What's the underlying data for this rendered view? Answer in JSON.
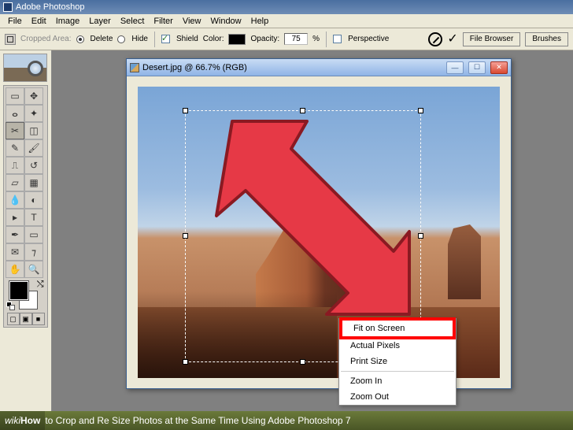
{
  "app": {
    "title": "Adobe Photoshop"
  },
  "menu": [
    "File",
    "Edit",
    "Image",
    "Layer",
    "Select",
    "Filter",
    "View",
    "Window",
    "Help"
  ],
  "optbar": {
    "cropped_area_label": "Cropped Area:",
    "delete_label": "Delete",
    "hide_label": "Hide",
    "shield_label": "Shield",
    "color_label": "Color:",
    "opacity_label": "Opacity:",
    "opacity_value": "75",
    "opacity_unit": "%",
    "perspective_label": "Perspective",
    "file_browser_tab": "File Browser",
    "brushes_tab": "Brushes"
  },
  "doc": {
    "title": "Desert.jpg @ 66.7% (RGB)"
  },
  "context_menu": {
    "fit_on_screen": "Fit on Screen",
    "actual_pixels": "Actual Pixels",
    "print_size": "Print Size",
    "zoom_in": "Zoom In",
    "zoom_out": "Zoom Out"
  },
  "caption": {
    "brand_prefix": "wiki",
    "brand_bold": "How",
    "text": " to Crop and Re Size Photos at the Same Time Using Adobe Photoshop 7"
  },
  "tool_names": {
    "marquee": "marquee-tool",
    "move": "move-tool",
    "lasso": "lasso-tool",
    "wand": "magic-wand-tool",
    "crop": "crop-tool",
    "slice": "slice-tool",
    "heal": "healing-brush-tool",
    "brush": "brush-tool",
    "stamp": "clone-stamp-tool",
    "history": "history-brush-tool",
    "eraser": "eraser-tool",
    "grad": "gradient-tool",
    "blur": "blur-tool",
    "dodge": "dodge-tool",
    "path": "path-select-tool",
    "type": "type-tool",
    "pen": "pen-tool",
    "shape": "shape-tool",
    "notes": "notes-tool",
    "eyedrop": "eyedropper-tool",
    "hand": "hand-tool",
    "zoom": "zoom-tool"
  }
}
